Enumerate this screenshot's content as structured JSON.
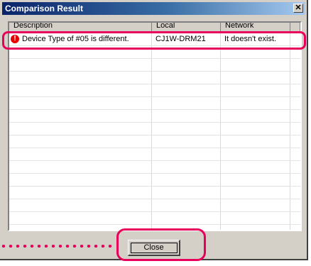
{
  "window": {
    "title": "Comparison Result",
    "close_symbol": "✕"
  },
  "table": {
    "columns": [
      "Description",
      "Local",
      "Network"
    ],
    "rows": [
      {
        "icon": "error-icon",
        "icon_glyph": "!",
        "description": "Device Type of #05 is different.",
        "local": "CJ1W-DRM21",
        "network": "It doesn't exist."
      }
    ]
  },
  "buttons": {
    "close_label": "Close"
  },
  "colors": {
    "highlight": "#e8005a",
    "titlebar_start": "#0a246a",
    "titlebar_end": "#a6caf0",
    "error_icon": "#e60000"
  }
}
